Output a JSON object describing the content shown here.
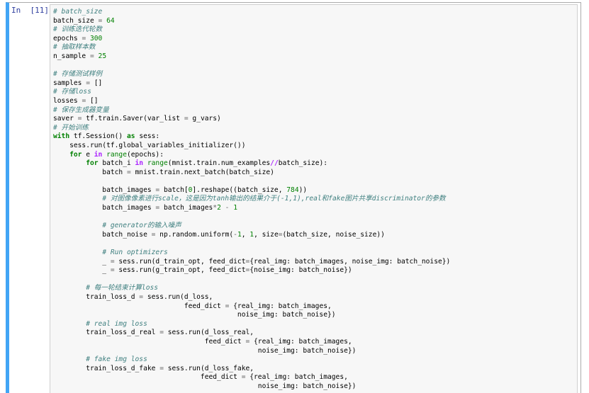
{
  "notebook": {
    "cell": {
      "prompt": "In  [11]:",
      "lines": [
        [
          {
            "t": "comment",
            "v": "# batch_size"
          }
        ],
        [
          {
            "t": "text",
            "v": "batch_size "
          },
          {
            "t": "equals",
            "v": "="
          },
          {
            "t": "text",
            "v": " "
          },
          {
            "t": "number",
            "v": "64"
          }
        ],
        [
          {
            "t": "comment",
            "v": "# 训练迭代轮数"
          }
        ],
        [
          {
            "t": "text",
            "v": "epochs "
          },
          {
            "t": "equals",
            "v": "="
          },
          {
            "t": "text",
            "v": " "
          },
          {
            "t": "number",
            "v": "300"
          }
        ],
        [
          {
            "t": "comment",
            "v": "# 抽取样本数"
          }
        ],
        [
          {
            "t": "text",
            "v": "n_sample "
          },
          {
            "t": "equals",
            "v": "="
          },
          {
            "t": "text",
            "v": " "
          },
          {
            "t": "number",
            "v": "25"
          }
        ],
        [],
        [
          {
            "t": "comment",
            "v": "# 存储测试样例"
          }
        ],
        [
          {
            "t": "text",
            "v": "samples "
          },
          {
            "t": "equals",
            "v": "="
          },
          {
            "t": "text",
            "v": " []"
          }
        ],
        [
          {
            "t": "comment",
            "v": "# 存储loss"
          }
        ],
        [
          {
            "t": "text",
            "v": "losses "
          },
          {
            "t": "equals",
            "v": "="
          },
          {
            "t": "text",
            "v": " []"
          }
        ],
        [
          {
            "t": "comment",
            "v": "# 保存生成器变量"
          }
        ],
        [
          {
            "t": "text",
            "v": "saver "
          },
          {
            "t": "equals",
            "v": "="
          },
          {
            "t": "text",
            "v": " tf.train.Saver(var_list "
          },
          {
            "t": "equals",
            "v": "="
          },
          {
            "t": "text",
            "v": " g_vars)"
          }
        ],
        [
          {
            "t": "comment",
            "v": "# 开始训练"
          }
        ],
        [
          {
            "t": "keyword",
            "v": "with"
          },
          {
            "t": "text",
            "v": " tf.Session() "
          },
          {
            "t": "keyword",
            "v": "as"
          },
          {
            "t": "text",
            "v": " sess:"
          }
        ],
        [
          {
            "t": "text",
            "v": "    sess.run(tf.global_variables_initializer())"
          }
        ],
        [
          {
            "t": "text",
            "v": "    "
          },
          {
            "t": "keyword",
            "v": "for"
          },
          {
            "t": "text",
            "v": " e "
          },
          {
            "t": "operator",
            "v": "in"
          },
          {
            "t": "text",
            "v": " "
          },
          {
            "t": "builtin",
            "v": "range"
          },
          {
            "t": "text",
            "v": "(epochs):"
          }
        ],
        [
          {
            "t": "text",
            "v": "        "
          },
          {
            "t": "keyword",
            "v": "for"
          },
          {
            "t": "text",
            "v": " batch_i "
          },
          {
            "t": "operator",
            "v": "in"
          },
          {
            "t": "text",
            "v": " "
          },
          {
            "t": "builtin",
            "v": "range"
          },
          {
            "t": "text",
            "v": "(mnist.train.num_examples"
          },
          {
            "t": "operator",
            "v": "//"
          },
          {
            "t": "text",
            "v": "batch_size):"
          }
        ],
        [
          {
            "t": "text",
            "v": "            batch "
          },
          {
            "t": "equals",
            "v": "="
          },
          {
            "t": "text",
            "v": " mnist.train.next_batch(batch_size)"
          }
        ],
        [],
        [
          {
            "t": "text",
            "v": "            batch_images "
          },
          {
            "t": "equals",
            "v": "="
          },
          {
            "t": "text",
            "v": " batch["
          },
          {
            "t": "number",
            "v": "0"
          },
          {
            "t": "text",
            "v": "].reshape((batch_size, "
          },
          {
            "t": "number",
            "v": "784"
          },
          {
            "t": "text",
            "v": "))"
          }
        ],
        [
          {
            "t": "text",
            "v": "            "
          },
          {
            "t": "comment",
            "v": "# 对图像像素进行scale，这是因为tanh输出的结果介于(-1,1),real和fake图片共享discriminator的参数"
          }
        ],
        [
          {
            "t": "text",
            "v": "            batch_images "
          },
          {
            "t": "equals",
            "v": "="
          },
          {
            "t": "text",
            "v": " batch_images"
          },
          {
            "t": "equals",
            "v": "*"
          },
          {
            "t": "number",
            "v": "2"
          },
          {
            "t": "text",
            "v": " "
          },
          {
            "t": "equals",
            "v": "-"
          },
          {
            "t": "text",
            "v": " "
          },
          {
            "t": "number",
            "v": "1"
          }
        ],
        [],
        [
          {
            "t": "text",
            "v": "            "
          },
          {
            "t": "comment",
            "v": "# generator的输入噪声"
          }
        ],
        [
          {
            "t": "text",
            "v": "            batch_noise "
          },
          {
            "t": "equals",
            "v": "="
          },
          {
            "t": "text",
            "v": " np.random.uniform("
          },
          {
            "t": "equals",
            "v": "-"
          },
          {
            "t": "number",
            "v": "1"
          },
          {
            "t": "text",
            "v": ", "
          },
          {
            "t": "number",
            "v": "1"
          },
          {
            "t": "text",
            "v": ", size"
          },
          {
            "t": "equals",
            "v": "="
          },
          {
            "t": "text",
            "v": "(batch_size, noise_size))"
          }
        ],
        [],
        [
          {
            "t": "text",
            "v": "            "
          },
          {
            "t": "comment",
            "v": "# Run optimizers"
          }
        ],
        [
          {
            "t": "text",
            "v": "            _ "
          },
          {
            "t": "equals",
            "v": "="
          },
          {
            "t": "text",
            "v": " sess.run(d_train_opt, feed_dict"
          },
          {
            "t": "equals",
            "v": "="
          },
          {
            "t": "text",
            "v": "{real_img: batch_images, noise_img: batch_noise})"
          }
        ],
        [
          {
            "t": "text",
            "v": "            _ "
          },
          {
            "t": "equals",
            "v": "="
          },
          {
            "t": "text",
            "v": " sess.run(g_train_opt, feed_dict"
          },
          {
            "t": "equals",
            "v": "="
          },
          {
            "t": "text",
            "v": "{noise_img: batch_noise})"
          }
        ],
        [],
        [
          {
            "t": "text",
            "v": "        "
          },
          {
            "t": "comment",
            "v": "# 每一轮结束计算loss"
          }
        ],
        [
          {
            "t": "text",
            "v": "        train_loss_d "
          },
          {
            "t": "equals",
            "v": "="
          },
          {
            "t": "text",
            "v": " sess.run(d_loss,"
          }
        ],
        [
          {
            "t": "text",
            "v": "                                feed_dict "
          },
          {
            "t": "equals",
            "v": "="
          },
          {
            "t": "text",
            "v": " {real_img: batch_images,"
          }
        ],
        [
          {
            "t": "text",
            "v": "                                             noise_img: batch_noise})"
          }
        ],
        [
          {
            "t": "text",
            "v": "        "
          },
          {
            "t": "comment",
            "v": "# real img loss"
          }
        ],
        [
          {
            "t": "text",
            "v": "        train_loss_d_real "
          },
          {
            "t": "equals",
            "v": "="
          },
          {
            "t": "text",
            "v": " sess.run(d_loss_real,"
          }
        ],
        [
          {
            "t": "text",
            "v": "                                     feed_dict "
          },
          {
            "t": "equals",
            "v": "="
          },
          {
            "t": "text",
            "v": " {real_img: batch_images,"
          }
        ],
        [
          {
            "t": "text",
            "v": "                                                  noise_img: batch_noise})"
          }
        ],
        [
          {
            "t": "text",
            "v": "        "
          },
          {
            "t": "comment",
            "v": "# fake img loss"
          }
        ],
        [
          {
            "t": "text",
            "v": "        train_loss_d_fake "
          },
          {
            "t": "equals",
            "v": "="
          },
          {
            "t": "text",
            "v": " sess.run(d_loss_fake,"
          }
        ],
        [
          {
            "t": "text",
            "v": "                                    feed_dict "
          },
          {
            "t": "equals",
            "v": "="
          },
          {
            "t": "text",
            "v": " {real_img: batch_images,"
          }
        ],
        [
          {
            "t": "text",
            "v": "                                                  noise_img: batch_noise})"
          }
        ]
      ]
    }
  },
  "colors": {
    "selected_cell_bar": "#42a5f5",
    "prompt": "#303f9f",
    "comment": "#408080",
    "keyword": "#008000",
    "operator": "#aa22ff",
    "input_background": "#f7f7f7"
  }
}
